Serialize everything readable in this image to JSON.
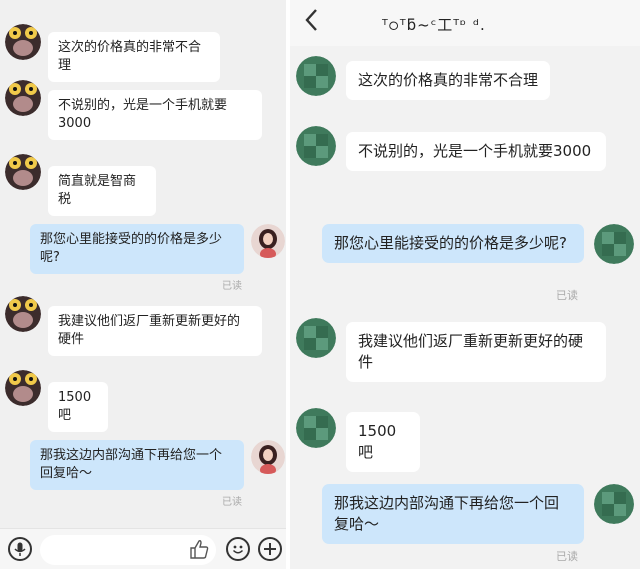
{
  "left_chat": {
    "messages": [
      {
        "text": "这次的价格真的非常不合理"
      },
      {
        "text": "不说别的，光是一个手机就要3000"
      },
      {
        "text": "简直就是智商税"
      },
      {
        "text": "那您心里能接受的的价格是多少呢?",
        "status": "已读"
      },
      {
        "text": "我建议他们返厂重新更新更好的硬件"
      },
      {
        "text": "1500吧"
      },
      {
        "text": "那我这边内部沟通下再给您一个回复哈～",
        "status": "已读"
      }
    ],
    "input_bar": {
      "voice_icon": "mic-icon",
      "like_icon": "thumbs-up-icon",
      "emoji_icon": "smile-icon",
      "add_icon": "plus-icon"
    }
  },
  "right_chat": {
    "header": {
      "back_icon": "back-chevron-icon",
      "title": "ᵀ੦ᵀƃ~ᶜ工ᵀᶛ ᵈ."
    },
    "messages": [
      {
        "text": "这次的价格真的非常不合理"
      },
      {
        "text": "不说别的，光是一个手机就要3000"
      },
      {
        "text": "那您心里能接受的的价格是多少呢?",
        "status": "已读"
      },
      {
        "text": "我建议他们返厂重新更新更好的硬件"
      },
      {
        "text": "1500吧"
      },
      {
        "text": "那我这边内部沟通下再给您一个回复哈～",
        "status": "已读"
      }
    ]
  }
}
